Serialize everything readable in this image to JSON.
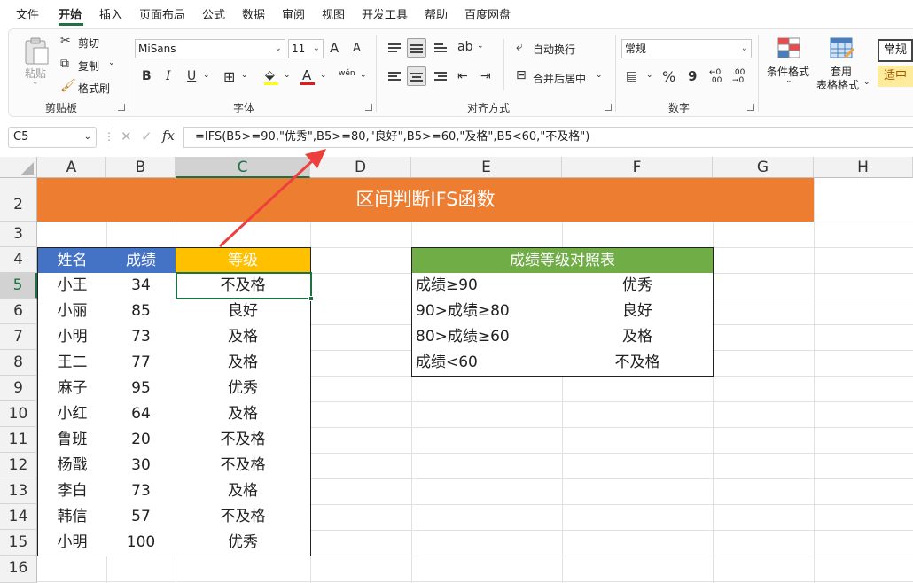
{
  "menu": [
    "文件",
    "开始",
    "插入",
    "页面布局",
    "公式",
    "数据",
    "审阅",
    "视图",
    "开发工具",
    "帮助",
    "百度网盘"
  ],
  "ribbon": {
    "clipboard": {
      "paste": "粘贴",
      "cut": "剪切",
      "copy": "复制",
      "format_painter": "格式刷",
      "label": "剪贴板"
    },
    "font": {
      "name": "MiSans",
      "size": "11",
      "grow": "A",
      "shrink": "A",
      "bold": "B",
      "italic": "I",
      "underline": "U",
      "phonetic": "wén",
      "label": "字体"
    },
    "alignment": {
      "wrap": "自动换行",
      "merge": "合并后居中",
      "label": "对齐方式"
    },
    "number": {
      "format": "常规",
      "percent": "%",
      "comma": "9",
      "label": "数字"
    },
    "styles": {
      "conditional": "条件格式",
      "table_line1": "套用",
      "table_line2": "表格格式",
      "normal": "常规",
      "good": "适中"
    }
  },
  "formula_bar": {
    "name_box": "C5",
    "fx": "fx",
    "formula": "=IFS(B5>=90,\"优秀\",B5>=80,\"良好\",B5>=60,\"及格\",B5<60,\"不及格\")"
  },
  "columns": [
    "A",
    "B",
    "C",
    "D",
    "E",
    "F",
    "G",
    "H"
  ],
  "rows": [
    "2",
    "3",
    "4",
    "5",
    "6",
    "7",
    "8",
    "9",
    "10",
    "11",
    "12",
    "13",
    "14",
    "15",
    "16"
  ],
  "sheet": {
    "banner": "区间判断IFS函数",
    "headers": [
      "姓名",
      "成绩",
      "等级"
    ],
    "records": [
      [
        "小王",
        "34",
        "不及格"
      ],
      [
        "小丽",
        "85",
        "良好"
      ],
      [
        "小明",
        "73",
        "及格"
      ],
      [
        "王二",
        "77",
        "及格"
      ],
      [
        "麻子",
        "95",
        "优秀"
      ],
      [
        "小红",
        "64",
        "及格"
      ],
      [
        "鲁班",
        "20",
        "不及格"
      ],
      [
        "杨戬",
        "30",
        "不及格"
      ],
      [
        "李白",
        "73",
        "及格"
      ],
      [
        "韩信",
        "57",
        "不及格"
      ],
      [
        "小明",
        "100",
        "优秀"
      ]
    ],
    "lookup_title": "成绩等级对照表",
    "lookup": [
      [
        "成绩≥90",
        "优秀"
      ],
      [
        "90>成绩≥80",
        "良好"
      ],
      [
        "80>成绩≥60",
        "及格"
      ],
      [
        "成绩<60",
        "不及格"
      ]
    ]
  },
  "colors": {
    "banner": "#ed7d31",
    "header_blue": "#4472c4",
    "header_gold": "#ffc000",
    "lookup_green": "#70ad47",
    "arrow": "#ee3f3f",
    "accent": "#1e7145"
  },
  "icons": [
    "paste-icon",
    "scissors-icon",
    "copy-icon",
    "format-painter-icon",
    "border-icon",
    "fill-color-icon",
    "font-color-icon",
    "wrap-text-icon",
    "merge-icon",
    "currency-icon",
    "conditional-format-icon",
    "table-format-icon",
    "cancel-icon",
    "confirm-icon"
  ]
}
